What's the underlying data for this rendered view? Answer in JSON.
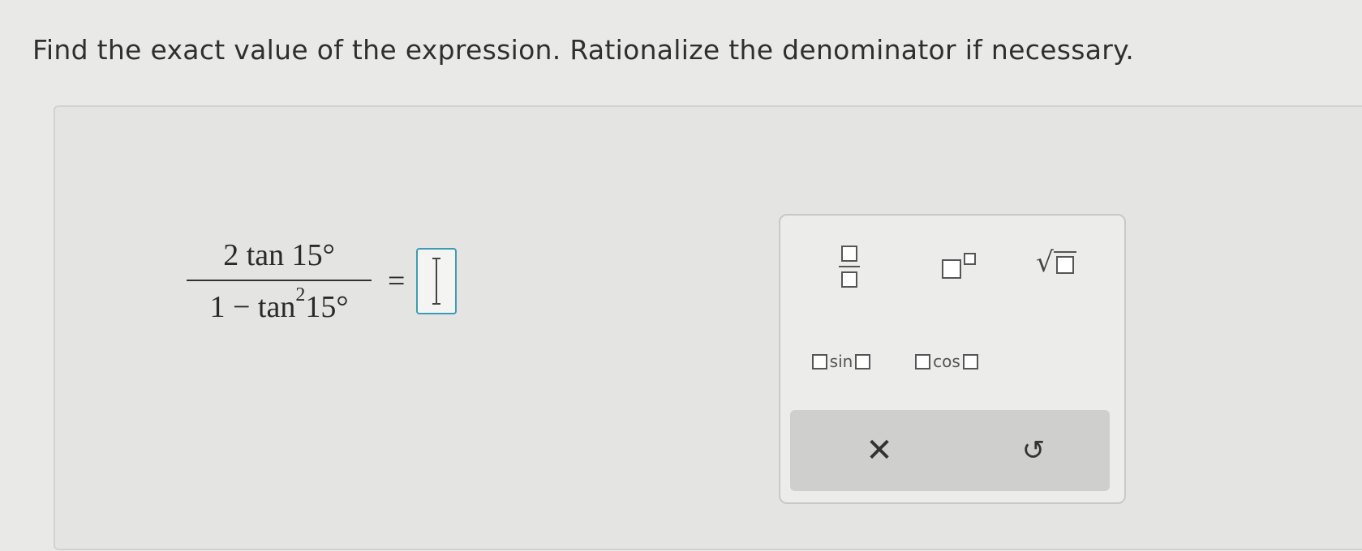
{
  "instruction": "Find the exact value of the expression. Rationalize the denominator if necessary.",
  "expression": {
    "numerator": "2 tan 15°",
    "denominator_prefix": "1 − tan",
    "denominator_exponent": "2",
    "denominator_suffix": "15°",
    "equals": "="
  },
  "answer": {
    "value": ""
  },
  "keypad": {
    "keys": [
      {
        "name": "fraction",
        "icon": "fraction-template-icon"
      },
      {
        "name": "exponent",
        "icon": "exponent-template-icon"
      },
      {
        "name": "square-root",
        "icon": "sqrt-template-icon",
        "symbol": "√"
      },
      {
        "name": "sine",
        "label": "sin"
      },
      {
        "name": "cosine",
        "label": "cos"
      }
    ],
    "actions": {
      "clear_symbol": "✕",
      "undo_symbol": "↺"
    }
  },
  "colors": {
    "answer_border": "#3f9bb5",
    "background": "#e9e9e7"
  }
}
